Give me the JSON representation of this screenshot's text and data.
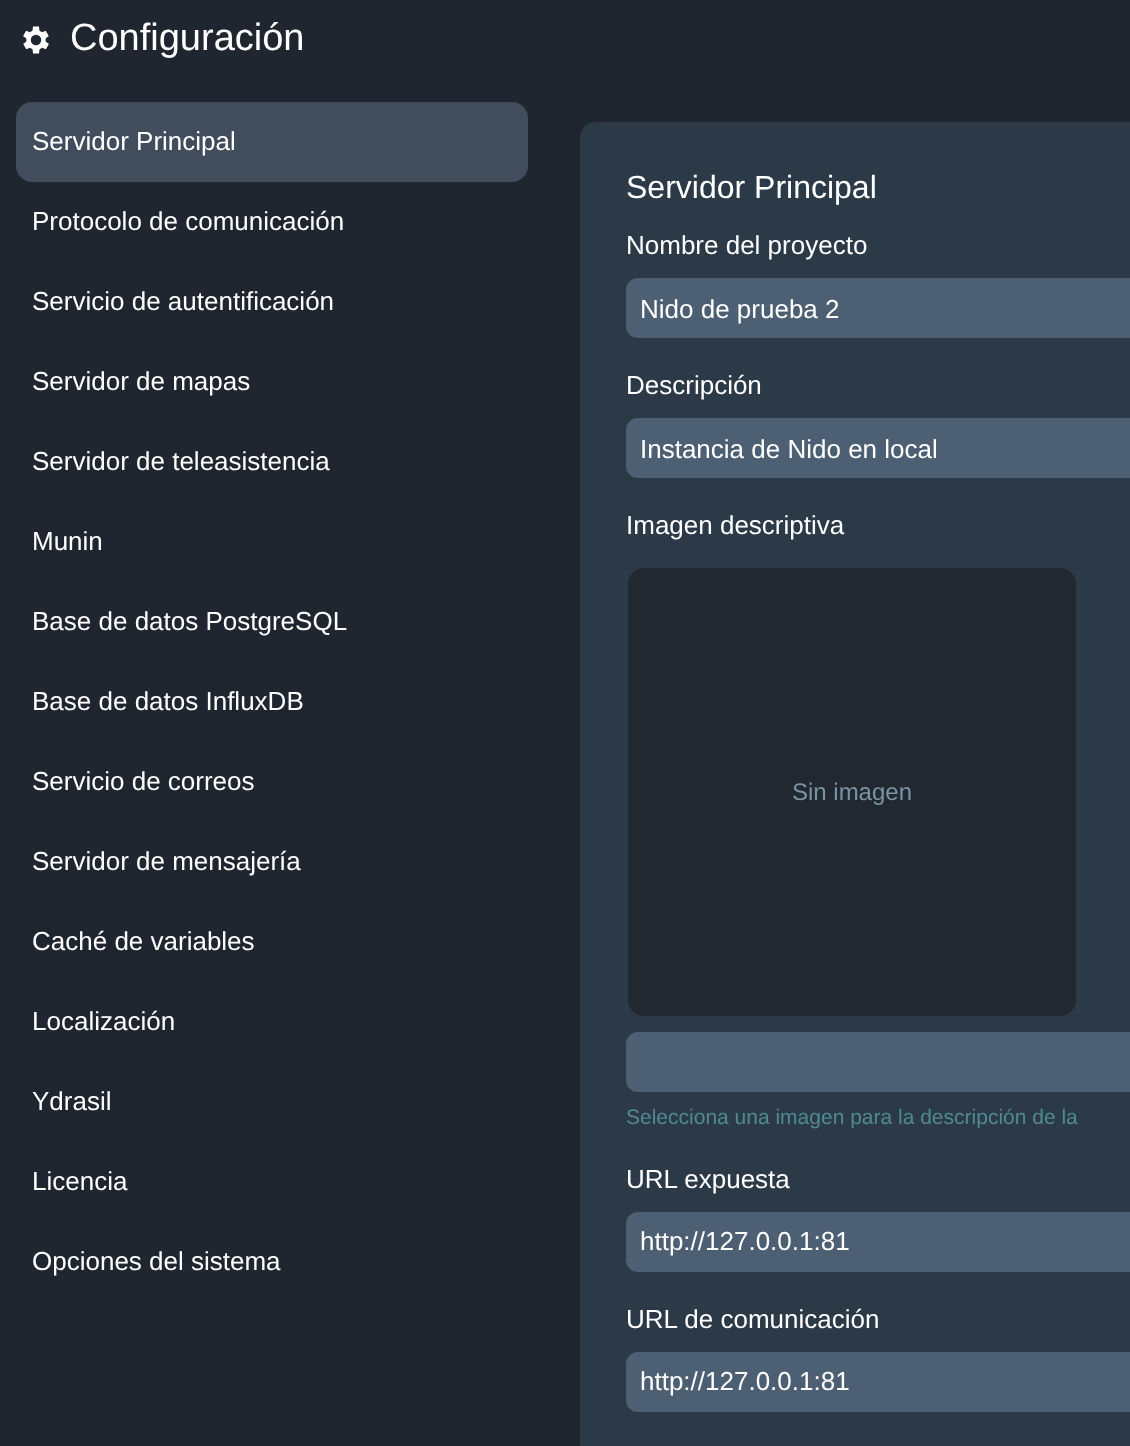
{
  "header": {
    "title": "Configuración"
  },
  "sidebar": {
    "items": [
      {
        "label": "Servidor Principal",
        "selected": true
      },
      {
        "label": "Protocolo de comunicación",
        "selected": false
      },
      {
        "label": "Servicio de autentificación",
        "selected": false
      },
      {
        "label": "Servidor de mapas",
        "selected": false
      },
      {
        "label": "Servidor de teleasistencia",
        "selected": false
      },
      {
        "label": "Munin",
        "selected": false
      },
      {
        "label": "Base de datos PostgreSQL",
        "selected": false
      },
      {
        "label": "Base de datos InfluxDB",
        "selected": false
      },
      {
        "label": "Servicio de correos",
        "selected": false
      },
      {
        "label": "Servidor de mensajería",
        "selected": false
      },
      {
        "label": "Caché de variables",
        "selected": false
      },
      {
        "label": "Localización",
        "selected": false
      },
      {
        "label": "Ydrasil",
        "selected": false
      },
      {
        "label": "Licencia",
        "selected": false
      },
      {
        "label": "Opciones del sistema",
        "selected": false
      }
    ]
  },
  "panel": {
    "title": "Servidor Principal",
    "fields": [
      {
        "kind": "text",
        "label": "Nombre del proyecto",
        "value": "Nido de prueba 2"
      },
      {
        "kind": "text",
        "label": "Descripción",
        "value": "Instancia de Nido en local"
      },
      {
        "kind": "image",
        "label": "Imagen descriptiva",
        "empty_text": "Sin imagen",
        "hint": "Selecciona una imagen para la descripción de la"
      },
      {
        "kind": "text",
        "label": "URL expuesta",
        "value": "http://127.0.0.1:81"
      },
      {
        "kind": "text",
        "label": "URL de comunicación",
        "value": "http://127.0.0.1:81"
      }
    ]
  }
}
